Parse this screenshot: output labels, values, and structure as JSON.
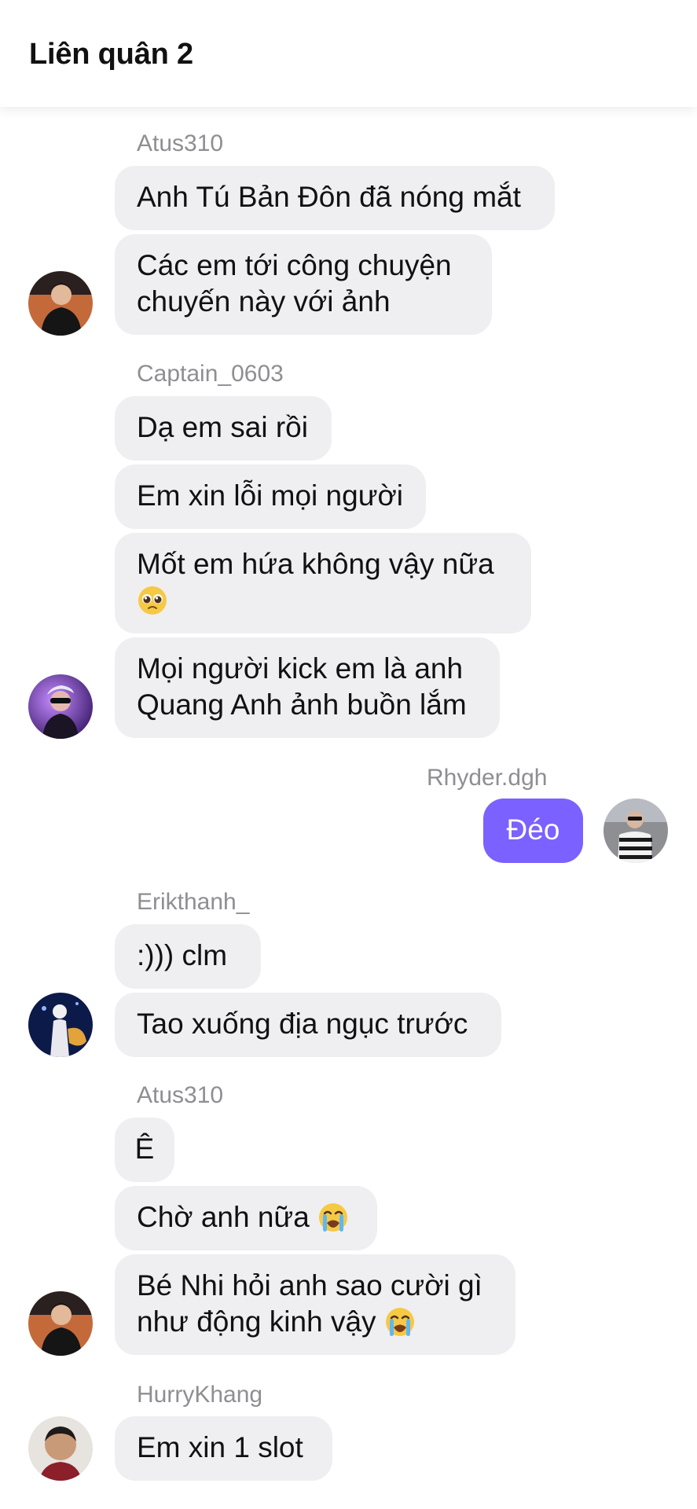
{
  "header": {
    "title": "Liên quân 2"
  },
  "groups": [
    {
      "sender": "Atus310",
      "messages": [
        "Anh Tú Bản Đôn đã nóng mắt",
        "Các em tới công chuyện",
        "chuyến này với ảnh"
      ]
    },
    {
      "sender": "Captain_0603",
      "messages": [
        "Dạ em sai rồi",
        "Em xin lỗi mọi người",
        "Mốt em hứa không vậy nữa",
        "Mọi người kick em là anh",
        "Quang Anh ảnh buồn lắm"
      ],
      "emoji_1": "pleading-face-emoji"
    },
    {
      "sender": "Rhyder.dgh",
      "messages": [
        "Đéo"
      ]
    },
    {
      "sender": "Erikthanh_",
      "messages": [
        ":))) clm",
        "Tao xuống địa ngục trước"
      ]
    },
    {
      "sender": "Atus310",
      "messages": [
        "Ê",
        "Chờ anh nữa",
        "Bé Nhi hỏi anh sao cười gì",
        "như động kinh vậy"
      ],
      "emoji_1": "loudly-crying-face-emoji"
    },
    {
      "sender": "HurryKhang",
      "messages": [
        "Em xin 1 slot"
      ]
    }
  ],
  "colors": {
    "incoming_bubble": "#efeff1",
    "outgoing_bubble": "#7b61ff",
    "sender_name": "#8e8e93"
  }
}
